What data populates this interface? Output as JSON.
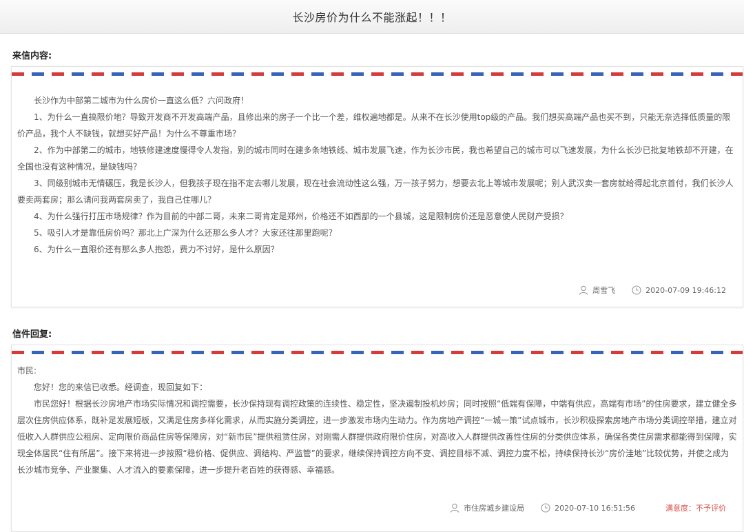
{
  "page": {
    "title": "长沙房价为什么不能涨起！！！"
  },
  "letter": {
    "section_label": "来信内容:",
    "paragraphs": [
      "长沙作为中部第二城市为什么房价一直这么低？六问政府！",
      "1、为什么一直搞限价地？导致开发商不开发高端产品，且修出来的房子一个比一个差，维权遍地都是。从来不在长沙使用top级的产品。我们想买高端产品也买不到，只能无奈选择低质量的限价产品，我个人不缺钱，就想买好产品！为什么不尊重市场？",
      "2、作为中部第二的城市，地铁修建速度慢得令人发指，别的城市同时在建多条地铁线、城市发展飞速，作为长沙市民，我也希望自己的城市可以飞速发展，为什么长沙已批复地铁却不开建，在全国也没有这种情况，是缺钱吗？",
      "3、同级别城市无情碾压，我是长沙人，但我孩子现在指不定去哪儿发展，现在社会流动性这么强，万一孩子努力，想要去北上等城市发展呢；别人武汉卖一套房就给得起北京首付，我们长沙人要卖两套房；那么请问我两套房卖了，我自己住哪儿？",
      "4、为什么强行打压市场规律？作为目前的中部二哥，未来二哥肯定是郑州，价格还不如西部的一个县城，这是限制房价还是恶意使人民财产受损？",
      "5、吸引人才是靠低房价吗？那北上广深为什么还那么多人才？大家还往那里跑呢？",
      "6、为什么一直限价还有那么多人抱怨，费力不讨好，是什么原因？"
    ],
    "author": "周雪飞",
    "datetime": "2020-07-09 19:46:12"
  },
  "reply": {
    "section_label": "信件回复:",
    "salutation": "市民:",
    "paragraphs": [
      "您好！您的来信已收悉。经调查，现回复如下：",
      "市民您好！根据长沙房地产市场实际情况和调控需要，长沙保持现有调控政策的连续性、稳定性，坚决遏制投机炒房；同时按照“低端有保障，中端有供应，高端有市场”的住房要求，建立健全多层次住房供应体系，既补足发展短板，又满足住房多样化需求，从而实施分类调控，进一步激发市场内生动力。作为房地产调控“一城一策”试点城市，长沙积极探索房地产市场分类调控举措，建立对低收入人群供应公租房、定向限价商品住房等保障房，对“新市民”提供租赁住房，对刚需人群提供政府限价住房，对高收入人群提供改善性住房的分类供应体系，确保各类住房需求都能得到保障，实现全体居民“住有所居”。接下来将进一步按照“稳价格、促供应、调结构、严监管”的要求，继续保持调控方向不变、调控目标不减、调控力度不松，持续保持长沙“房价洼地”比较优势，并使之成为长沙城市竞争、产业聚集、人才流入的要素保障，进一步提升老百姓的获得感、幸福感。"
    ],
    "author": "市住房城乡建设局",
    "datetime": "2020-07-10 16:51:56",
    "satisfaction": "满意度：不予评价"
  },
  "icons": {
    "user": "user-icon",
    "clock": "clock-icon"
  },
  "colors": {
    "airmail_red": "#d43c3c",
    "airmail_blue": "#3763b8",
    "satisfaction": "#d9534f"
  }
}
